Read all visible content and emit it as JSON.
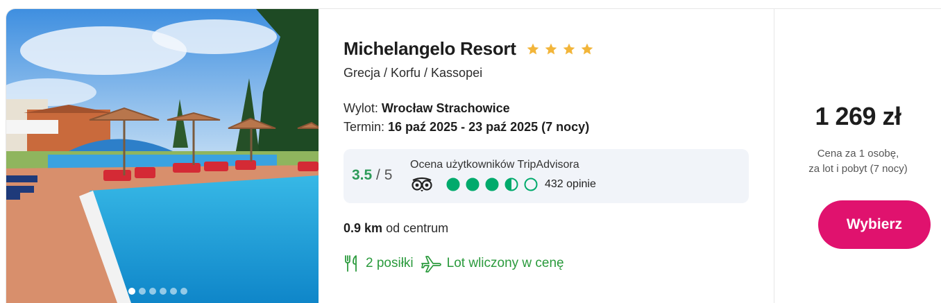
{
  "hotel": {
    "name": "Michelangelo Resort",
    "stars": 4,
    "location": "Grecja / Korfu / Kassopei"
  },
  "flight": {
    "departure_label": "Wylot:",
    "departure_value": "Wrocław Strachowice",
    "term_label": "Termin:",
    "term_value": "16 paź 2025 - 23 paź 2025 (7 nocy)"
  },
  "tripadvisor": {
    "score": "3.5",
    "scale": "/ 5",
    "label": "Ocena użytkowników TripAdvisora",
    "rating": 3.5,
    "reviews": "432 opinie",
    "color": "#00aa6c"
  },
  "distance": {
    "value": "0.9 km",
    "suffix": "od centrum"
  },
  "features": [
    {
      "icon": "cutlery-icon",
      "label": "2 posiłki"
    },
    {
      "icon": "airplane-icon",
      "label": "Lot wliczony w cenę"
    }
  ],
  "price": {
    "amount": "1 269 zł",
    "note_line1": "Cena za 1 osobę,",
    "note_line2": "za lot i pobyt (7 nocy)"
  },
  "button": {
    "label": "Wybierz",
    "color": "#e0126e"
  },
  "gallery": {
    "total_images": 6,
    "active_index": 0
  },
  "colors": {
    "star": "#f2b53a",
    "feature_green": "#2a9a3c"
  }
}
